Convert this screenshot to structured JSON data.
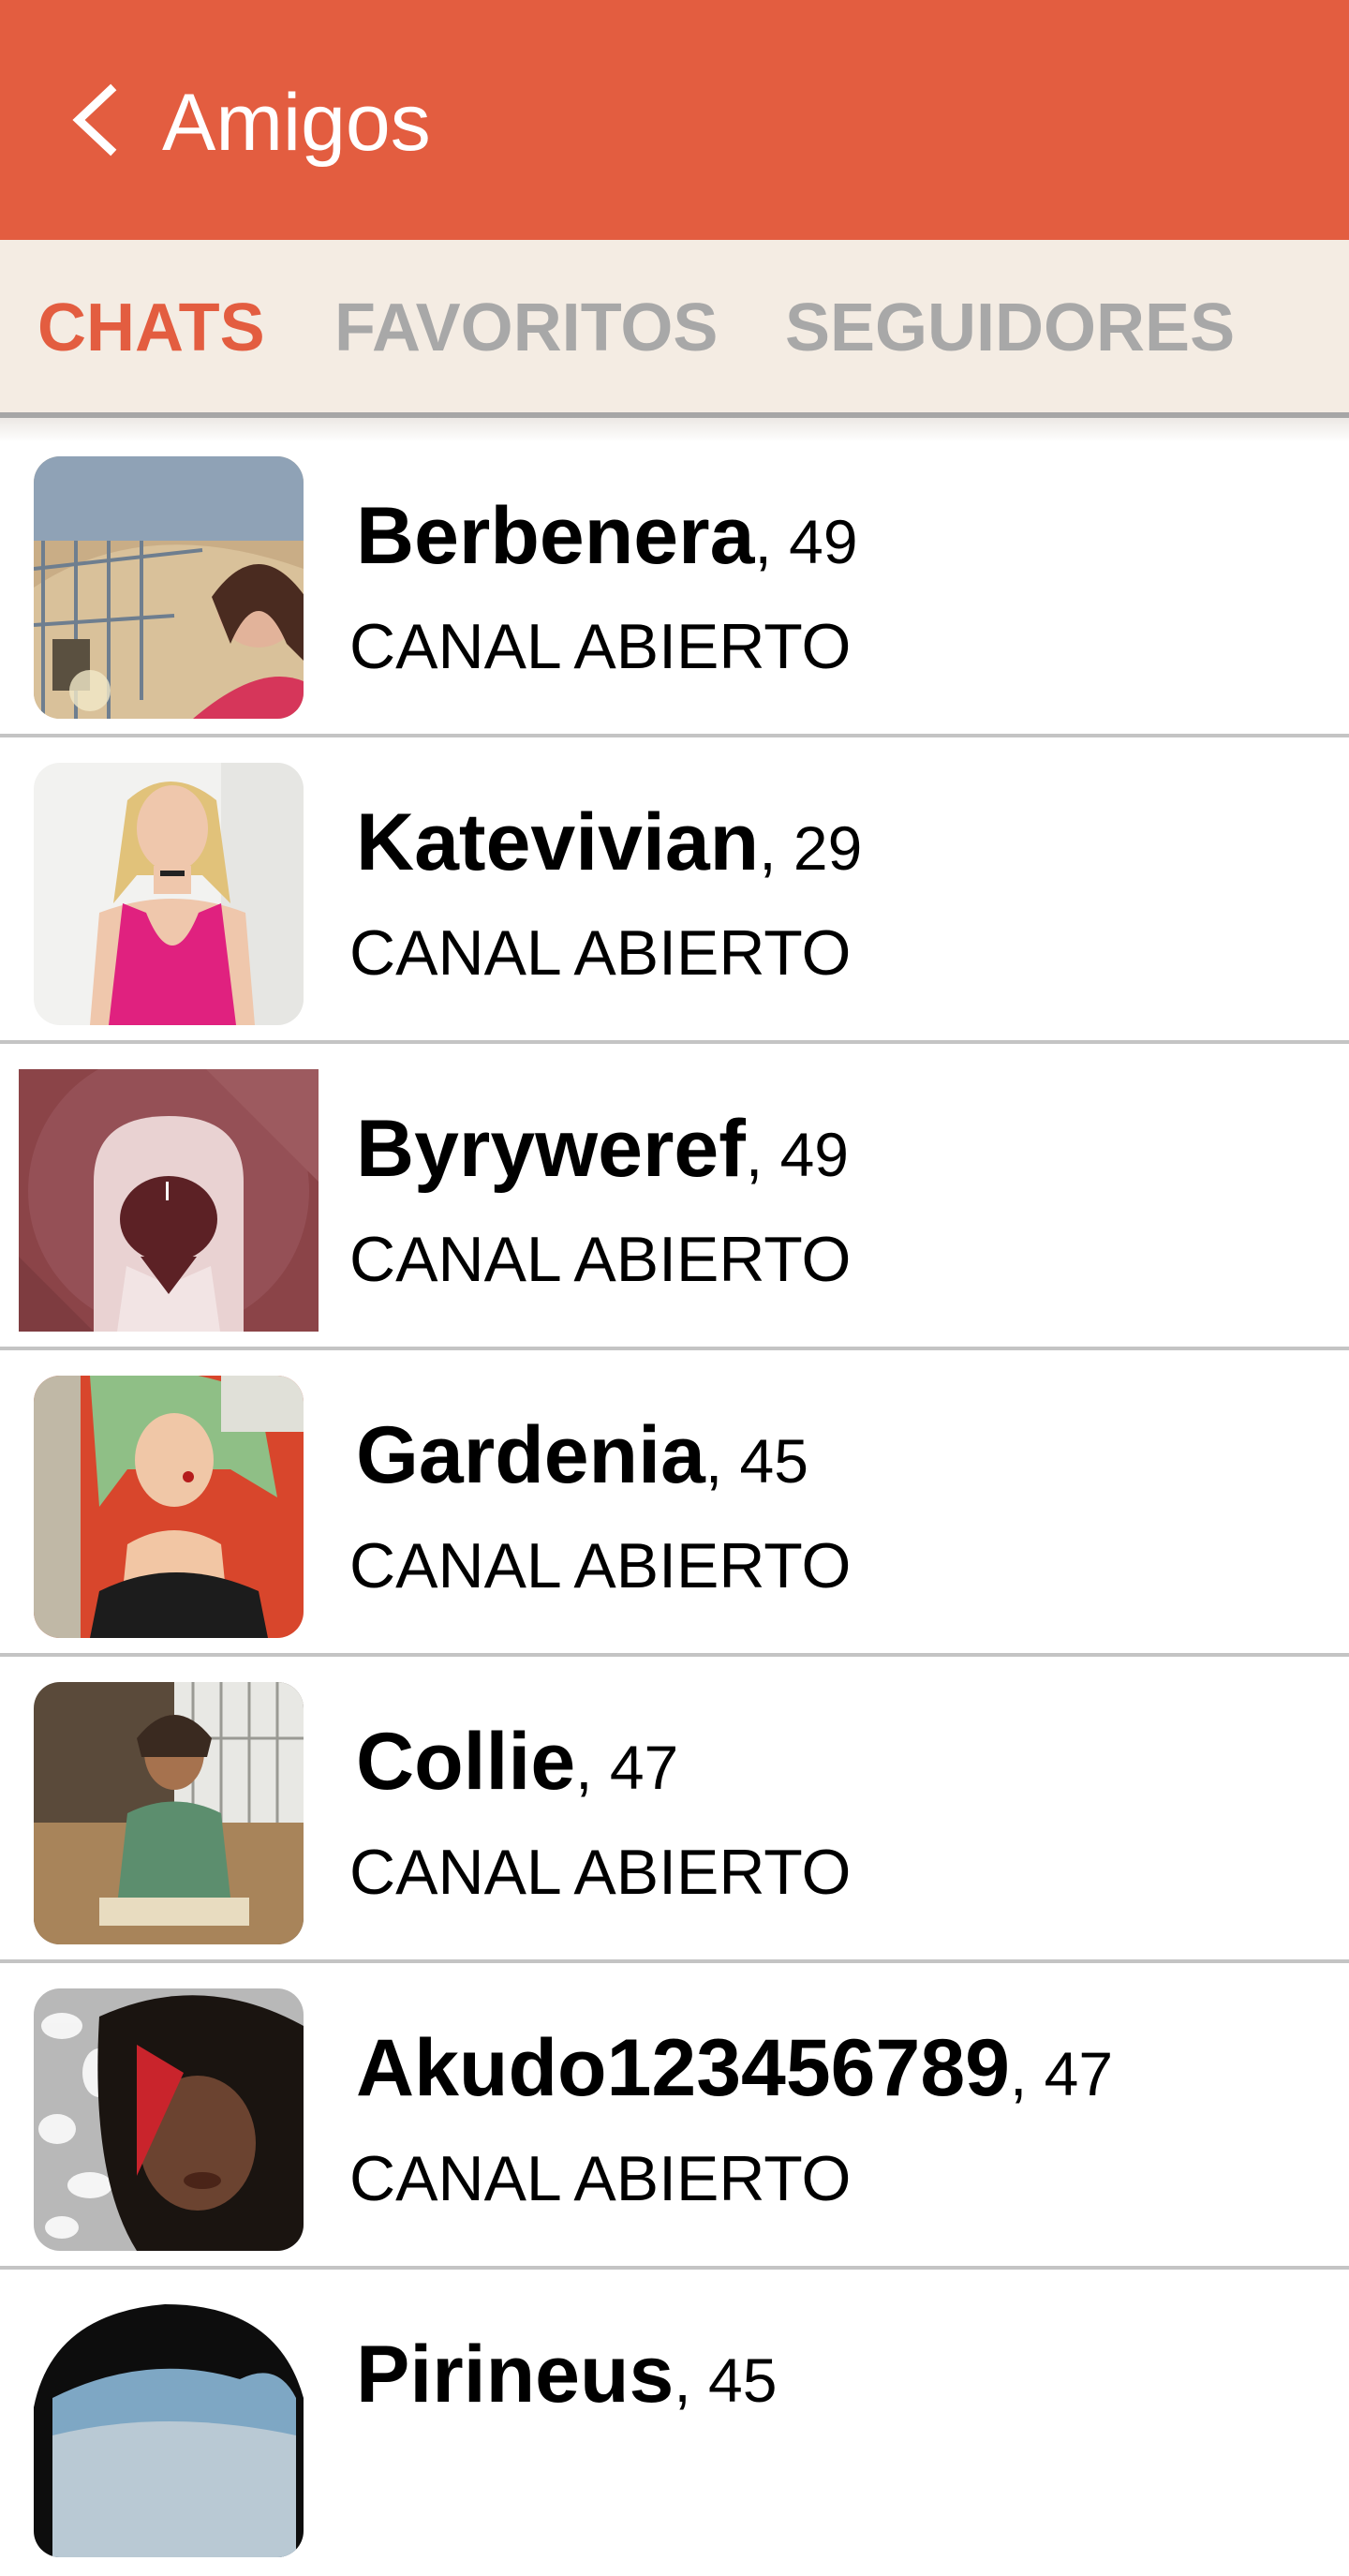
{
  "header": {
    "title": "Amigos",
    "back_icon": "chevron-left-icon",
    "background_color": "#e35d40"
  },
  "tabs": [
    {
      "label": "CHATS",
      "active": true
    },
    {
      "label": "FAVORITOS",
      "active": false
    },
    {
      "label": "SEGUIDORES",
      "active": false
    }
  ],
  "colors": {
    "accent": "#e35d40",
    "tab_inactive": "#a8a8a8",
    "tab_background": "#f4ece3"
  },
  "contacts": [
    {
      "name": "Berbenera",
      "age_text": ", 49",
      "status": "CANAL ABIERTO"
    },
    {
      "name": "Katevivian",
      "age_text": ", 29",
      "status": "CANAL ABIERTO"
    },
    {
      "name": "Byryweref",
      "age_text": ", 49",
      "status": "CANAL ABIERTO"
    },
    {
      "name": "Gardenia",
      "age_text": ", 45",
      "status": "CANAL ABIERTO"
    },
    {
      "name": "Collie",
      "age_text": ", 47",
      "status": "CANAL ABIERTO"
    },
    {
      "name": "Akudo123456789",
      "age_text": ", 47",
      "status": "CANAL ABIERTO"
    },
    {
      "name": "Pirineus",
      "age_text": ", 45",
      "status": ""
    }
  ]
}
